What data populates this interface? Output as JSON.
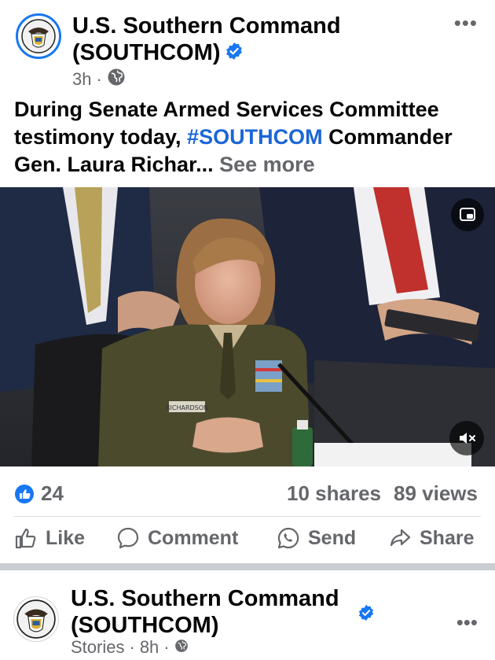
{
  "post": {
    "author": "U.S. Southern Command (SOUTHCOM)",
    "time": "3h",
    "dot": "·",
    "caption_lead": "During Senate Armed Services Committee testimony today, ",
    "hashtag": "#SOUTHCOM",
    "caption_tail": " Commander Gen. Laura Richar...",
    "see_more": "See more",
    "more_menu": "•••",
    "video": {
      "nameplate": "RICHARDSON",
      "controls": [
        "picture-in-picture-icon",
        "mute-icon"
      ]
    },
    "reactions_count": "24",
    "shares": "10 shares",
    "views": "89 views"
  },
  "actions": {
    "like": "Like",
    "comment": "Comment",
    "send": "Send",
    "share": "Share"
  },
  "next_post": {
    "author": "U.S. Southern Command (SOUTHCOM)",
    "source": "Stories",
    "dot": "·",
    "time": "8h",
    "dot2": "·",
    "more_menu": "•••"
  },
  "colors": {
    "accent": "#1877f2",
    "hashtag": "#1b65d8",
    "secondary_text": "#65676b",
    "separator": "#cacdd1"
  }
}
